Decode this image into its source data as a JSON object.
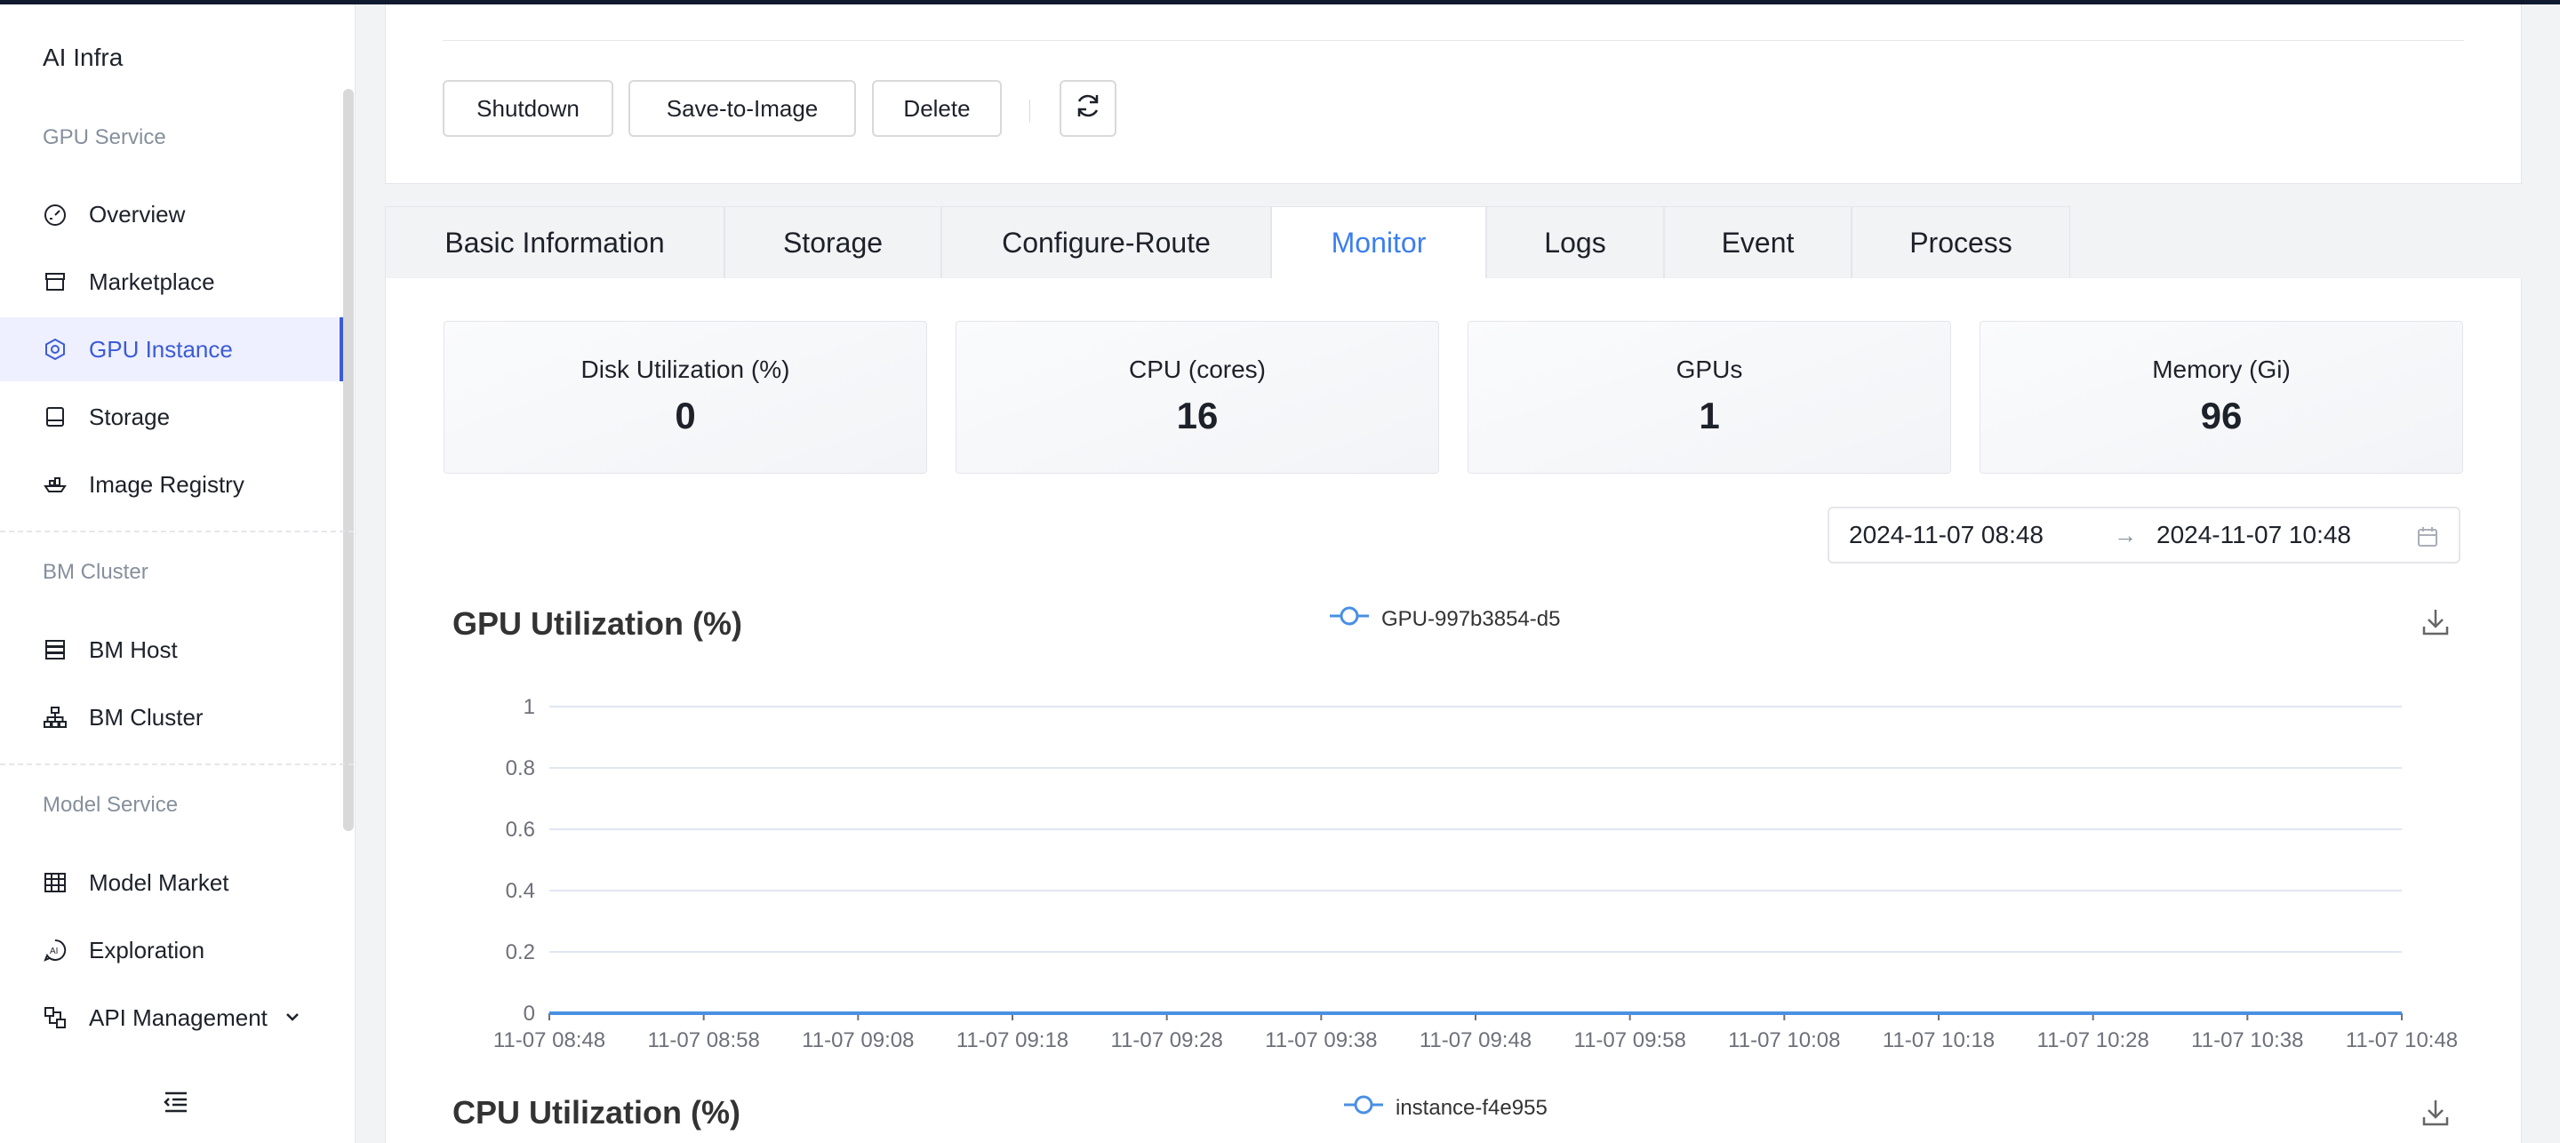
{
  "sidebar": {
    "brand": "AI Infra",
    "groups": [
      "GPU Service",
      "BM Cluster",
      "Model Service"
    ],
    "items": [
      {
        "label": "Overview",
        "icon": "dashboard-icon"
      },
      {
        "label": "Marketplace",
        "icon": "store-icon"
      },
      {
        "label": "GPU Instance",
        "icon": "gpu-icon",
        "active": true
      },
      {
        "label": "Storage",
        "icon": "drive-icon"
      },
      {
        "label": "Image Registry",
        "icon": "ship-icon"
      },
      {
        "label": "BM Host",
        "icon": "server-rack-icon"
      },
      {
        "label": "BM Cluster",
        "icon": "cluster-icon"
      },
      {
        "label": "Model Market",
        "icon": "grid-store-icon"
      },
      {
        "label": "Exploration",
        "icon": "ai-chat-icon"
      },
      {
        "label": "API Management",
        "icon": "api-icon"
      }
    ]
  },
  "actions": {
    "shutdown": "Shutdown",
    "save_to_image": "Save-to-Image",
    "delete": "Delete"
  },
  "tabs": [
    "Basic Information",
    "Storage",
    "Configure-Route",
    "Monitor",
    "Logs",
    "Event",
    "Process"
  ],
  "active_tab": "Monitor",
  "stats": [
    {
      "label": "Disk Utilization (%)",
      "value": "0"
    },
    {
      "label": "CPU (cores)",
      "value": "16"
    },
    {
      "label": "GPUs",
      "value": "1"
    },
    {
      "label": "Memory (Gi)",
      "value": "96"
    }
  ],
  "time_range": {
    "from": "2024-11-07 08:48",
    "arrow": "→",
    "to": "2024-11-07 10:48"
  },
  "colors": {
    "accent": "#3c7ef0",
    "nav_active": "#3c5bd6",
    "series": "#4a90e2"
  },
  "chart_data": [
    {
      "type": "line",
      "title": "GPU Utilization (%)",
      "x": [
        "11-07 08:48",
        "11-07 08:58",
        "11-07 09:08",
        "11-07 09:18",
        "11-07 09:28",
        "11-07 09:38",
        "11-07 09:48",
        "11-07 09:58",
        "11-07 10:08",
        "11-07 10:18",
        "11-07 10:28",
        "11-07 10:38",
        "11-07 10:48"
      ],
      "yticks": [
        "0",
        "0.2",
        "0.4",
        "0.6",
        "0.8",
        "1"
      ],
      "ylim": [
        0,
        1
      ],
      "series": [
        {
          "name": "GPU-997b3854-d5",
          "values": [
            0,
            0,
            0,
            0,
            0,
            0,
            0,
            0,
            0,
            0,
            0,
            0,
            0
          ]
        }
      ],
      "legend": "top-center",
      "grid": true
    },
    {
      "type": "line",
      "title": "CPU Utilization (%)",
      "series": [
        {
          "name": "instance-f4e955"
        }
      ],
      "legend": "top-center"
    }
  ]
}
